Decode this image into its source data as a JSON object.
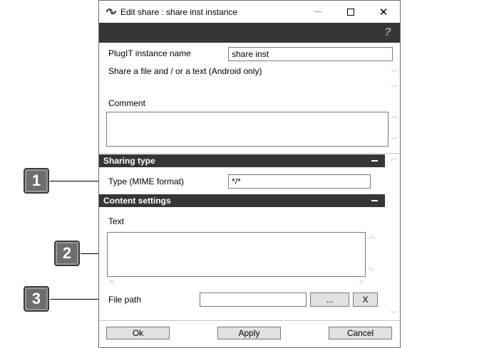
{
  "window": {
    "title": "Edit share : share inst instance",
    "min_icon": "minimize-icon",
    "max_icon": "maximize-icon",
    "close_glyph": "✕"
  },
  "help": {
    "glyph": "?"
  },
  "instance_name": {
    "label": "PlugIT instance name",
    "value": "share inst"
  },
  "description": {
    "text": "Share a file and / or a text (Android only)"
  },
  "comment": {
    "label": "Comment",
    "value": ""
  },
  "sharing_type": {
    "header": "Sharing type",
    "type_label": "Type (MIME format)",
    "type_value": "*/*"
  },
  "content_settings": {
    "header": "Content settings",
    "text_label": "Text",
    "text_value": "",
    "file_path_label": "File path",
    "file_path_value": "",
    "browse_label": "...",
    "clear_label": "X"
  },
  "footer": {
    "ok": "Ok",
    "apply": "Apply",
    "cancel": "Cancel"
  },
  "callouts": [
    "1",
    "2",
    "3"
  ],
  "scroll_glyphs": {
    "up": "︿",
    "down": "﹀",
    "left": "<",
    "right": ">"
  },
  "colors": {
    "dark_header": "#363636",
    "callout_fill": "#6e6e6e"
  }
}
